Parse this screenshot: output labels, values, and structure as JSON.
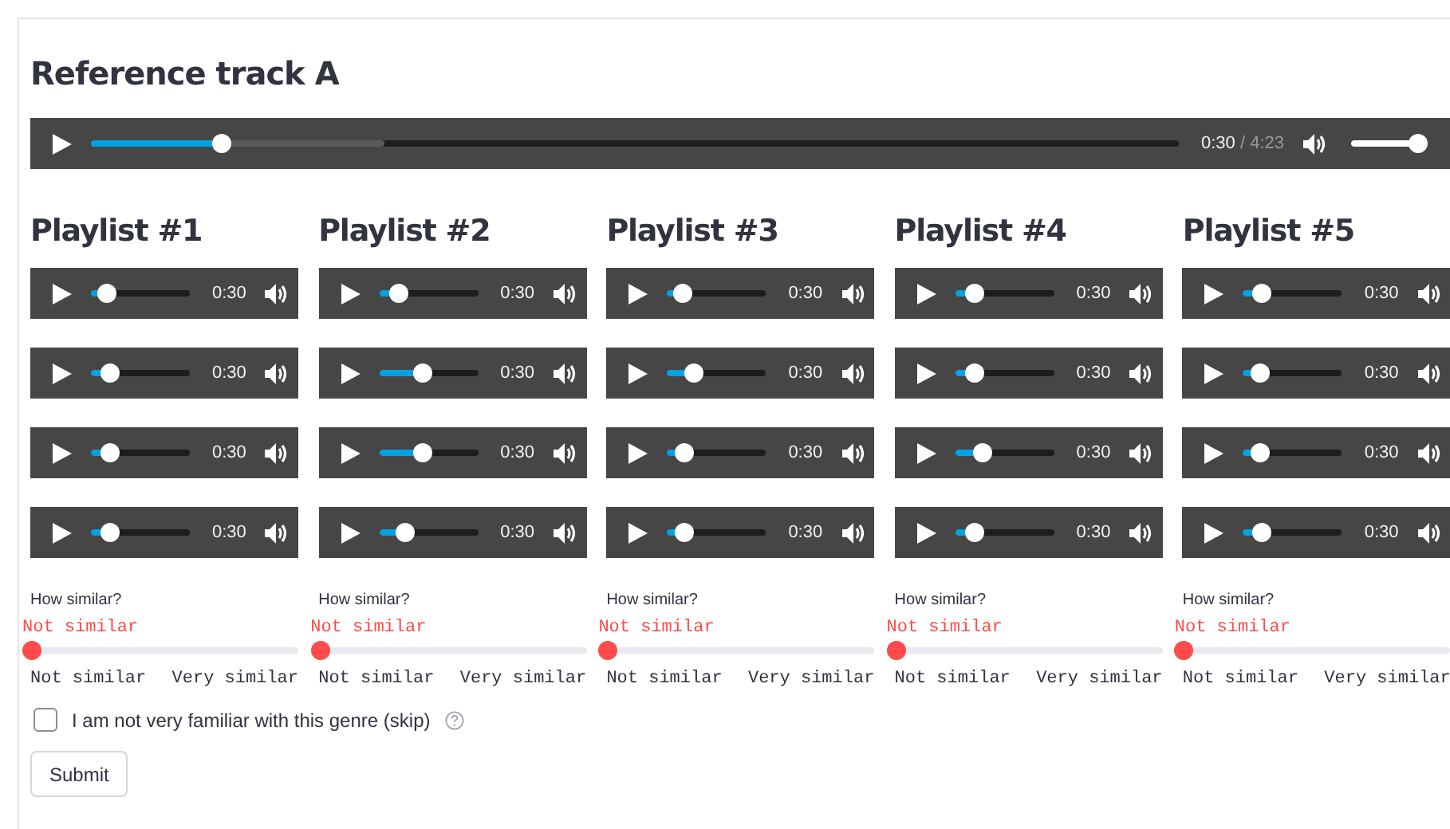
{
  "reference": {
    "title": "Reference track A",
    "player": {
      "time": "0:30",
      "duration": "/ 4:23",
      "level": 0.12,
      "volume": {
        "level": 1
      }
    }
  },
  "playlists": [
    {
      "title": "Playlist #1",
      "tracks": [
        {
          "time": "0:30",
          "level": 0.16
        },
        {
          "time": "0:30",
          "level": 0.19
        },
        {
          "time": "0:30",
          "level": 0.19
        },
        {
          "time": "0:30",
          "level": 0.19
        }
      ],
      "rating": {
        "label": "How similar?",
        "value": "Not similar",
        "level": 0,
        "min_label": "Not similar",
        "max_label": "Very similar"
      }
    },
    {
      "title": "Playlist #2",
      "tracks": [
        {
          "time": "0:30",
          "level": 0.2
        },
        {
          "time": "0:30",
          "level": 0.44
        },
        {
          "time": "0:30",
          "level": 0.45
        },
        {
          "time": "0:30",
          "level": 0.26
        }
      ],
      "rating": {
        "label": "How similar?",
        "value": "Not similar",
        "level": 0,
        "min_label": "Not similar",
        "max_label": "Very similar"
      }
    },
    {
      "title": "Playlist #3",
      "tracks": [
        {
          "time": "0:30",
          "level": 0.16
        },
        {
          "time": "0:30",
          "level": 0.27
        },
        {
          "time": "0:30",
          "level": 0.18
        },
        {
          "time": "0:30",
          "level": 0.18
        }
      ],
      "rating": {
        "label": "How similar?",
        "value": "Not similar",
        "level": 0,
        "min_label": "Not similar",
        "max_label": "Very similar"
      }
    },
    {
      "title": "Playlist #4",
      "tracks": [
        {
          "time": "0:30",
          "level": 0.19
        },
        {
          "time": "0:30",
          "level": 0.2
        },
        {
          "time": "0:30",
          "level": 0.27
        },
        {
          "time": "0:30",
          "level": 0.2
        }
      ],
      "rating": {
        "label": "How similar?",
        "value": "Not similar",
        "level": 0,
        "min_label": "Not similar",
        "max_label": "Very similar"
      }
    },
    {
      "title": "Playlist #5",
      "tracks": [
        {
          "time": "0:30",
          "level": 0.18
        },
        {
          "time": "0:30",
          "level": 0.17
        },
        {
          "time": "0:30",
          "level": 0.17
        },
        {
          "time": "0:30",
          "level": 0.19
        }
      ],
      "rating": {
        "label": "How similar?",
        "value": "Not similar",
        "level": 0,
        "min_label": "Not similar",
        "max_label": "Very similar"
      }
    }
  ],
  "skip": {
    "label": "I am not very familiar with this genre (skip)",
    "checked": false
  },
  "submit": {
    "label": "Submit"
  }
}
